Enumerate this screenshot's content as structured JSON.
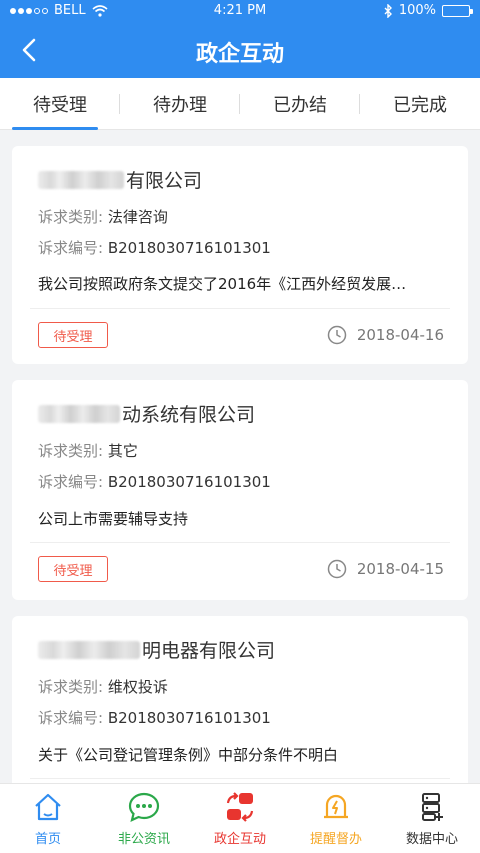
{
  "status_bar": {
    "carrier": "BELL",
    "time": "4:21 PM",
    "battery": "100%"
  },
  "header": {
    "title": "政企互动",
    "back_icon": "chevron-left-icon"
  },
  "tabs": [
    {
      "label": "待受理",
      "active": true
    },
    {
      "label": "待办理",
      "active": false
    },
    {
      "label": "已办结",
      "active": false
    },
    {
      "label": "已完成",
      "active": false
    }
  ],
  "cards": [
    {
      "company_suffix": "有限公司",
      "category_label": "诉求类别:",
      "category_value": "法律咨询",
      "number_label": "诉求编号:",
      "number_value": "B2018030716101301",
      "description": "我公司按照政府条文提交了2016年《江西外经贸发展…",
      "status": "待受理",
      "date": "2018-04-16"
    },
    {
      "company_suffix": "动系统有限公司",
      "category_label": "诉求类别:",
      "category_value": "其它",
      "number_label": "诉求编号:",
      "number_value": "B2018030716101301",
      "description": "公司上市需要辅导支持",
      "status": "待受理",
      "date": "2018-04-15"
    },
    {
      "company_suffix": "明电器有限公司",
      "category_label": "诉求类别:",
      "category_value": "维权投诉",
      "number_label": "诉求编号:",
      "number_value": "B2018030716101301",
      "description": "关于《公司登记管理条例》中部分条件不明白",
      "status": "",
      "date": ""
    }
  ],
  "bottom_nav": [
    {
      "label": "首页",
      "icon": "home-icon",
      "color": "#2f8cf0"
    },
    {
      "label": "非公资讯",
      "icon": "chat-icon",
      "color": "#2ba84a"
    },
    {
      "label": "政企互动",
      "icon": "interaction-icon",
      "color": "#e8352f"
    },
    {
      "label": "提醒督办",
      "icon": "alert-icon",
      "color": "#f5a623"
    },
    {
      "label": "数据中心",
      "icon": "data-icon",
      "color": "#333333"
    }
  ]
}
